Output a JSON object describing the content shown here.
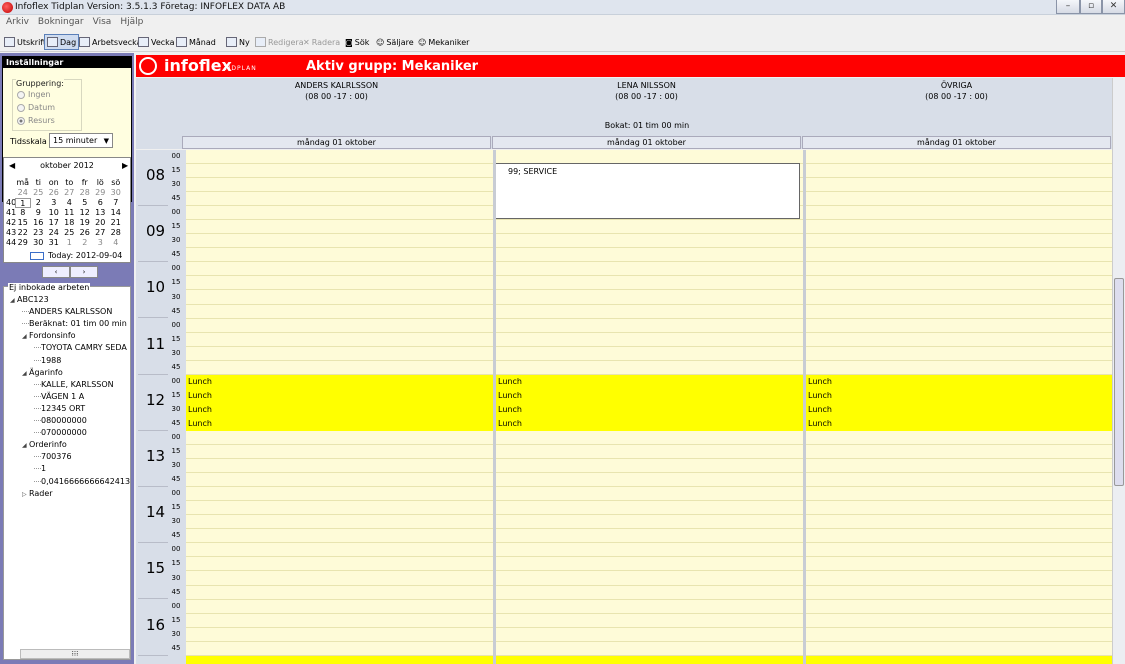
{
  "window": {
    "title": "Infoflex Tidplan Version: 3.5.1.3  Företag: INFOFLEX DATA AB"
  },
  "menu": [
    "Arkiv",
    "Bokningar",
    "Visa",
    "Hjälp"
  ],
  "toolbar": {
    "utskrift": "Utskrift",
    "dag": "Dag",
    "arbetsvecka": "Arbetsvecka",
    "vecka": "Vecka",
    "manad": "Månad",
    "ny": "Ny",
    "redigera": "Redigera",
    "radera": "Radera",
    "sok": "Sök",
    "saljare": "Säljare",
    "mekaniker": "Mekaniker"
  },
  "settings": {
    "header": "Inställningar",
    "grouping_label": "Gruppering:",
    "options": [
      "Ingen",
      "Datum",
      "Resurs"
    ],
    "selected": "Resurs",
    "tidsskala_label": "Tidsskala",
    "tidsskala_value": "15 minuter"
  },
  "calendar": {
    "month": "oktober 2012",
    "days": [
      "må",
      "ti",
      "on",
      "to",
      "fr",
      "lö",
      "sö"
    ],
    "weeks": [
      {
        "wk": "",
        "d": [
          "24",
          "25",
          "26",
          "27",
          "28",
          "29",
          "30"
        ]
      },
      {
        "wk": "40",
        "d": [
          "1",
          "2",
          "3",
          "4",
          "5",
          "6",
          "7"
        ]
      },
      {
        "wk": "41",
        "d": [
          "8",
          "9",
          "10",
          "11",
          "12",
          "13",
          "14"
        ]
      },
      {
        "wk": "42",
        "d": [
          "15",
          "16",
          "17",
          "18",
          "19",
          "20",
          "21"
        ]
      },
      {
        "wk": "43",
        "d": [
          "22",
          "23",
          "24",
          "25",
          "26",
          "27",
          "28"
        ]
      },
      {
        "wk": "44",
        "d": [
          "29",
          "30",
          "31",
          "1",
          "2",
          "3",
          "4"
        ]
      }
    ],
    "today": "Today: 2012-09-04"
  },
  "inbokade": {
    "header": "Ej inbokade arbeten",
    "nodes": [
      {
        "text": "ABC123",
        "level": 0,
        "exp": "◢"
      },
      {
        "text": "ANDERS KALRLSSON",
        "level": 1
      },
      {
        "text": "Beräknat: 01 tim 00 min",
        "level": 1
      },
      {
        "text": "Fordonsinfo",
        "level": 1,
        "exp": "◢"
      },
      {
        "text": "TOYOTA CAMRY SEDA",
        "level": 2
      },
      {
        "text": "1988",
        "level": 2
      },
      {
        "text": "Ägarinfo",
        "level": 1,
        "exp": "◢"
      },
      {
        "text": "KALLE, KARLSSON",
        "level": 2
      },
      {
        "text": "VÄGEN 1 A",
        "level": 2
      },
      {
        "text": "12345  ORT",
        "level": 2
      },
      {
        "text": "080000000",
        "level": 2
      },
      {
        "text": "070000000",
        "level": 2
      },
      {
        "text": "Orderinfo",
        "level": 1,
        "exp": "◢"
      },
      {
        "text": "700376",
        "level": 2
      },
      {
        "text": "1",
        "level": 2
      },
      {
        "text": "0,0416666666642413",
        "level": 2
      },
      {
        "text": "Rader",
        "level": 1,
        "exp": "▷"
      }
    ]
  },
  "banner": {
    "brand": "infoflex",
    "sub": "TIDPLAN",
    "group": "Aktiv grupp: Mekaniker"
  },
  "resources": [
    {
      "name": "ANDERS KALRLSSON",
      "hours": "(08  00 -17 : 00)"
    },
    {
      "name": "LENA NILSSON",
      "hours": "(08  00 -17 : 00)"
    },
    {
      "name": "ÖVRIGA",
      "hours": "(08  00 -17 : 00)"
    }
  ],
  "bokat": "Bokat: 01 tim 00 min",
  "day_header": "måndag 01 oktober",
  "hours": [
    "08",
    "09",
    "10",
    "11",
    "12",
    "13",
    "14",
    "15",
    "16"
  ],
  "minutes": [
    "00",
    "15",
    "30",
    "45"
  ],
  "lunch_label": "Lunch",
  "booking": {
    "text": "99; SERVICE"
  },
  "colors": {
    "banner": "#ff0000",
    "lunch": "#ffff00",
    "slot": "#fefbd8",
    "booking_bar": "#1a2fbf"
  }
}
